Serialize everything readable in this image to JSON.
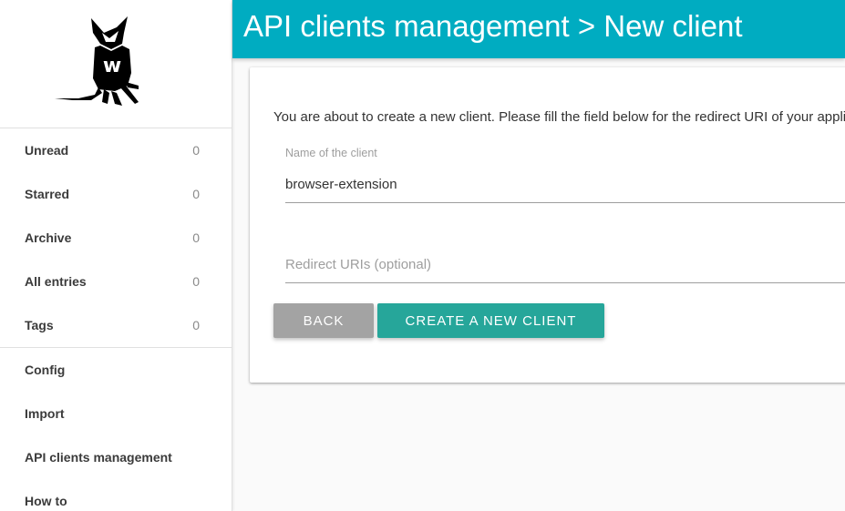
{
  "header": {
    "title": "API clients management > New client",
    "color": "#00acc1"
  },
  "sidebar": {
    "logo_icon": "wallabag-logo",
    "items": [
      {
        "label": "Unread",
        "count": "0"
      },
      {
        "label": "Starred",
        "count": "0"
      },
      {
        "label": "Archive",
        "count": "0"
      },
      {
        "label": "All entries",
        "count": "0"
      },
      {
        "label": "Tags",
        "count": "0"
      }
    ],
    "menu": [
      {
        "label": "Config"
      },
      {
        "label": "Import"
      },
      {
        "label": "API clients management"
      },
      {
        "label": "How to"
      }
    ]
  },
  "form": {
    "intro": "You are about to create a new client. Please fill the field below for the redirect URI of your application.",
    "name_label": "Name of the client",
    "name_value": "browser-extension",
    "redirect_placeholder": "Redirect URIs (optional)",
    "redirect_value": "",
    "back_label": "BACK",
    "create_label": "CREATE A NEW CLIENT",
    "back_color": "#a3a3a3",
    "create_color": "#26a69a"
  }
}
